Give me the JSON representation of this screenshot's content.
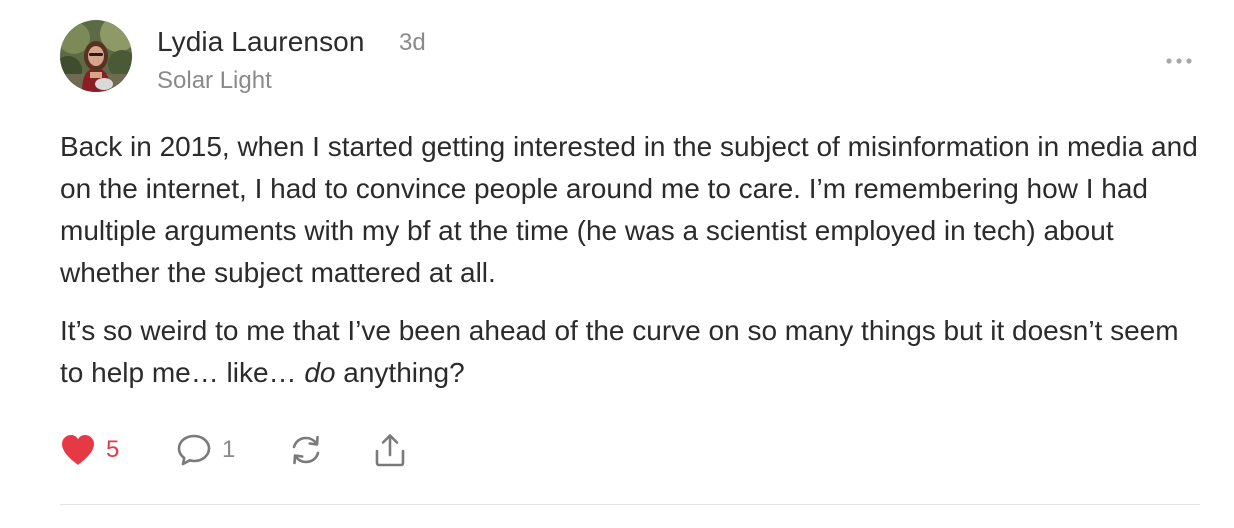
{
  "post": {
    "author": {
      "name": "Lydia Laurenson",
      "timestamp": "3d",
      "publication": "Solar Light",
      "avatar_icon": "profile-photo"
    },
    "more_icon": "more-horizontal-icon",
    "body": {
      "paragraph_1": "Back in 2015, when I started getting interested in the subject of misinformation in media and on the internet, I had to convince people around me to care. I’m remembering how I had multiple arguments with my bf at the time (he was a scientist employed in tech) about whether the subject mattered at all.",
      "paragraph_2_before": "It’s so weird to me that I’ve been ahead of the curve on so many things but it doesn’t seem to help me… like… ",
      "paragraph_2_emphasis": "do",
      "paragraph_2_after": " anything?"
    },
    "actions": {
      "like": {
        "icon": "heart-icon",
        "count": "5",
        "liked": true,
        "color": "#e63946"
      },
      "comment": {
        "icon": "comment-icon",
        "count": "1"
      },
      "restack": {
        "icon": "restack-icon"
      },
      "share": {
        "icon": "share-icon"
      }
    }
  }
}
